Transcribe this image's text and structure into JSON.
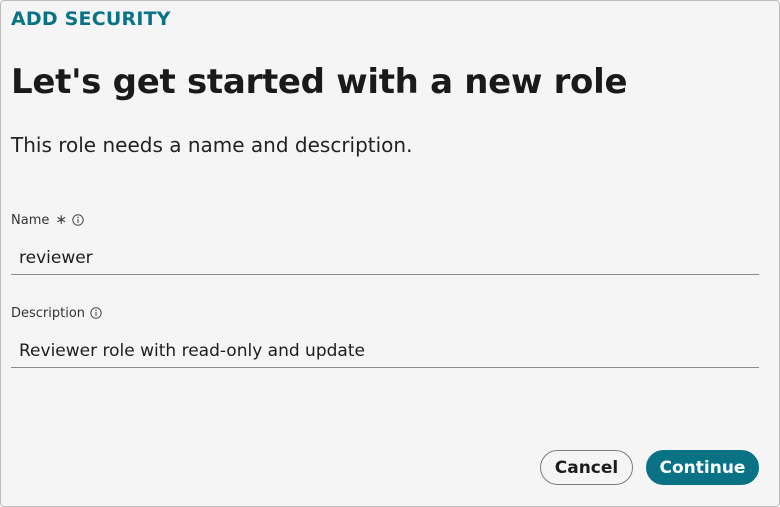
{
  "dialog": {
    "eyebrow": "ADD SECURITY",
    "title": "Let's get started with a new role",
    "subtitle": "This role needs a name and description."
  },
  "fields": {
    "name": {
      "label": "Name",
      "required_marker": "∗",
      "value": "reviewer",
      "info_icon": "info-circle-icon"
    },
    "description": {
      "label": "Description",
      "value": "Reviewer role with read-only and update",
      "info_icon": "info-circle-icon"
    }
  },
  "actions": {
    "cancel_label": "Cancel",
    "continue_label": "Continue"
  },
  "colors": {
    "accent": "#0a7285",
    "background": "#f4f5f4",
    "text": "#1d1d1d"
  }
}
